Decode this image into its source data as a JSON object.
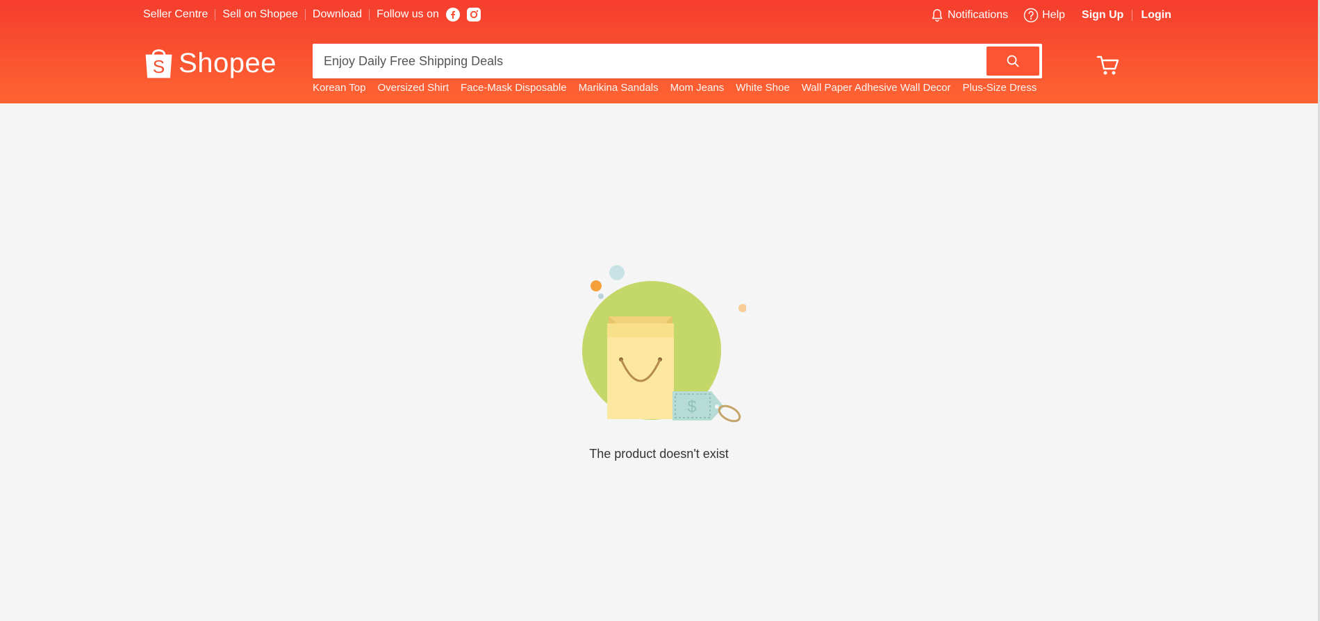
{
  "topbar": {
    "seller_centre": "Seller Centre",
    "sell_on_shopee": "Sell on Shopee",
    "download": "Download",
    "follow_us": "Follow us on",
    "social": [
      {
        "icon": "facebook-icon"
      },
      {
        "icon": "instagram-icon"
      }
    ],
    "notifications": "Notifications",
    "help": "Help",
    "sign_up": "Sign Up",
    "login": "Login"
  },
  "logo": {
    "text": "Shopee",
    "bag_letter": "S"
  },
  "search": {
    "placeholder": "Enjoy Daily Free Shipping Deals",
    "value": "",
    "button_icon": "search-icon"
  },
  "suggestions": [
    "Korean Top",
    "Oversized Shirt",
    "Face-Mask Disposable",
    "Marikina Sandals",
    "Mom Jeans",
    "White Shoe",
    "Wall Paper Adhesive Wall Decor",
    "Plus-Size Dress"
  ],
  "cart": {
    "icon": "shopping-cart-icon"
  },
  "empty_state": {
    "message": "The product doesn't exist",
    "price_tag_symbol": "$"
  },
  "colors": {
    "brand_top": "#f53d2d",
    "brand_bottom": "#fe6433",
    "background": "#f5f5f5",
    "illustration_circle": "#c4d86a",
    "bag": "#fbe79e",
    "tag": "#b7dcd6"
  }
}
